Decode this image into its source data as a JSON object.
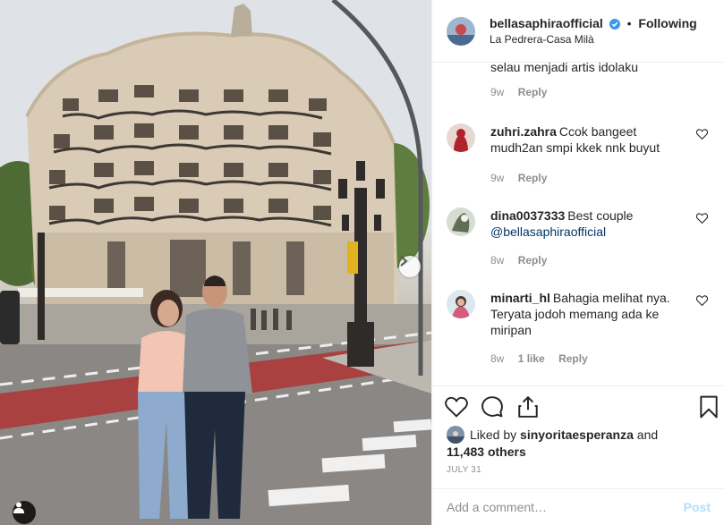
{
  "post": {
    "username": "bellasaphiraofficial",
    "follow_status": "Following",
    "location": "La Pedrera-Casa Milà"
  },
  "comments": [
    {
      "user": "",
      "text": "selau menjadi artis idolaku",
      "time": "9w",
      "likes": "",
      "reply": "Reply"
    },
    {
      "user": "zuhri.zahra",
      "text": "Ccok bangeet mudh2an smpi kkek nnk buyut",
      "time": "9w",
      "likes": "",
      "reply": "Reply"
    },
    {
      "user": "dina0037333",
      "text": "Best couple",
      "mention": "@bellasaphiraofficial",
      "time": "8w",
      "likes": "",
      "reply": "Reply"
    },
    {
      "user": "minarti_hl",
      "text": "Bahagia melihat nya. Teryata jodoh memang ada ke miripan",
      "time": "8w",
      "likes": "1 like",
      "reply": "Reply"
    }
  ],
  "likes": {
    "prefix": "Liked by",
    "user": "sinyoritaesperanza",
    "connector": "and",
    "others": "11,483 others"
  },
  "date": "JULY 31",
  "add_comment": {
    "placeholder": "Add a comment…",
    "post_label": "Post"
  },
  "colors": {
    "verified": "#3897f0",
    "mention": "#003569",
    "post_disabled": "#b2dffc",
    "meta_gray": "#8e8e8e"
  },
  "icons": [
    "verified-badge-icon",
    "heart-icon",
    "comment-icon",
    "share-icon",
    "bookmark-icon",
    "chevron-right-icon",
    "user-tag-icon"
  ]
}
